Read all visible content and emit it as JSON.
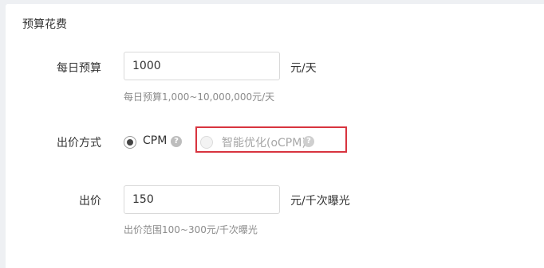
{
  "section": {
    "title": "预算花费"
  },
  "budget": {
    "label": "每日预算",
    "value": "1000",
    "unit": "元/天",
    "hint": "每日预算1,000~10,000,000元/天"
  },
  "bid_method": {
    "label": "出价方式",
    "options": [
      {
        "label": "CPM",
        "checked": true,
        "disabled": false
      },
      {
        "label": "智能优化(oCPM)",
        "checked": false,
        "disabled": true
      }
    ],
    "help_icon": "question-circle-icon"
  },
  "bid": {
    "label": "出价",
    "value": "150",
    "unit": "元/千次曝光",
    "hint": "出价范围100~300元/千次曝光"
  },
  "colors": {
    "highlight": "#d8343f",
    "panel_bg": "#ffffff",
    "page_bg": "#eef0f3"
  }
}
